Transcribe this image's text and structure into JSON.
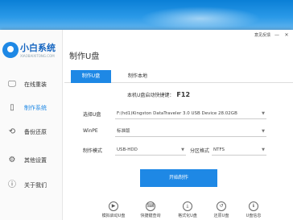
{
  "app": {
    "name": "小白系统",
    "url": "XIAOBAIXITONG.COM"
  },
  "window_controls": {
    "feedback": "意见反馈",
    "minimize": "—",
    "close": "✕"
  },
  "sidebar": {
    "items": [
      {
        "label": "在线重装",
        "icon": "monitor-icon",
        "glyph": "🖵"
      },
      {
        "label": "制作系统",
        "icon": "usb-icon",
        "glyph": "▯"
      },
      {
        "label": "备份还原",
        "icon": "backup-icon",
        "glyph": "⟲"
      },
      {
        "label": "其他设置",
        "icon": "settings-icon",
        "glyph": "⚙"
      },
      {
        "label": "关于我们",
        "icon": "info-icon",
        "glyph": "ⓘ"
      }
    ],
    "active_index": 1
  },
  "main": {
    "title": "制作U盘",
    "tabs": [
      {
        "label": "制作U盘"
      },
      {
        "label": "制作本地"
      }
    ],
    "boot_info": {
      "text": "本机U盘启动快捷键：",
      "key": "F12"
    },
    "form": {
      "usb_label": "选择U盘",
      "usb_value": "F:(hd1)Kingston DataTraveler 3.0 USB Device 28.02GB",
      "winpe_label": "WinPE",
      "winpe_value": "标准版",
      "mode_label": "制作模式",
      "mode_value": "USB-HDD",
      "format_label": "分区格式",
      "format_value": "NTFS"
    },
    "start_button": "开始制作"
  },
  "bottom": {
    "items": [
      {
        "label": "模拟启动U盘",
        "icon": "play-icon",
        "glyph": "▶"
      },
      {
        "label": "快捷键查询",
        "icon": "keyboard-icon",
        "glyph": "⌨"
      },
      {
        "label": "格式化U盘",
        "icon": "format-icon",
        "glyph": "⤓"
      },
      {
        "label": "还原U盘",
        "icon": "restore-icon",
        "glyph": "↺"
      },
      {
        "label": "U盘信息",
        "icon": "usb-info-icon",
        "glyph": "ℹ"
      }
    ]
  },
  "colors": {
    "accent": "#1e88e5",
    "desktop_top": "#0a7fd6"
  }
}
